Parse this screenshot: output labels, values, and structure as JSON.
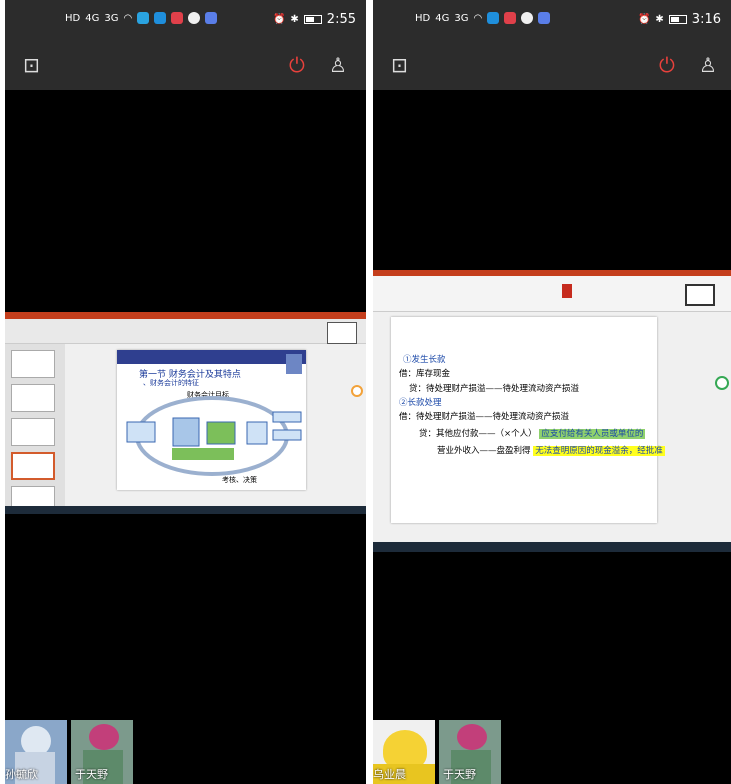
{
  "left_phone": {
    "status": {
      "signal_1": "4G",
      "signal_2": "3G",
      "time": "2:55"
    },
    "shared_slide": {
      "title": "第一节 财务会计及其特点",
      "subtitle": "、财务会计的特征",
      "target_label": "财务会计目标",
      "bottom_label": "考核、决策"
    },
    "participants": [
      {
        "name": "孙毓欣"
      },
      {
        "name": "于天野"
      }
    ]
  },
  "right_phone": {
    "status": {
      "signal_1": "4G",
      "signal_2": "3G",
      "time": "3:16"
    },
    "shared_slide": {
      "lines": {
        "l1": "①发生长款",
        "l2": "借：库存现金",
        "l3": "贷：待处理财产损溢——待处理流动资产损溢",
        "l4": "②长款处理",
        "l5": "借：待处理财产损溢——待处理流动资产损溢",
        "l6_prefix": "贷：其他应付款——（×个人）",
        "l6_highlight": "应支付给有关人员或单位的",
        "l7_prefix": "营业外收入——盘盈利得",
        "l7_highlight": "无法查明原因的现金溢余，经批准"
      }
    },
    "participants": [
      {
        "name": "乌业晨"
      },
      {
        "name": "于天野"
      }
    ]
  },
  "colors": {
    "power_red": "#e8413c",
    "ppt_orange": "#c43e1c",
    "slide_blue": "#1b48a8",
    "highlight_green": "#8fd16d",
    "highlight_yellow": "#ffff1e"
  }
}
